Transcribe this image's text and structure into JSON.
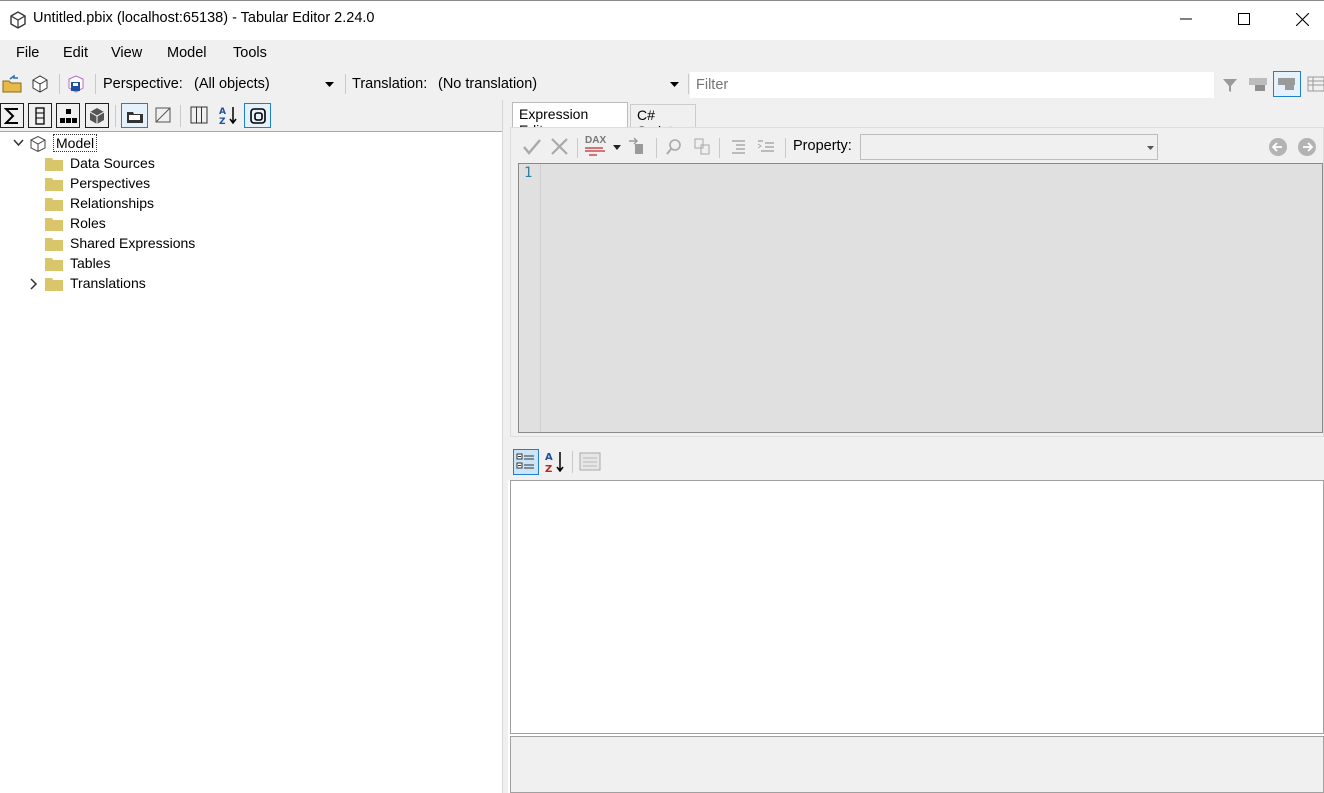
{
  "window": {
    "title": "Untitled.pbix (localhost:65138) - Tabular Editor 2.24.0",
    "icons": {
      "app": "tabular-editor-app-icon",
      "minimize": "minimize-icon",
      "maximize": "maximize-icon",
      "close": "close-icon"
    }
  },
  "menu": {
    "items": [
      "File",
      "Edit",
      "View",
      "Model",
      "Tools"
    ]
  },
  "toolbar": {
    "perspective_label": "Perspective:",
    "perspective_value": "(All objects)",
    "translation_label": "Translation:",
    "translation_value": "(No translation)",
    "filter_placeholder": "Filter"
  },
  "tree": {
    "root": "Model",
    "items": [
      {
        "label": "Data Sources",
        "expandable": false
      },
      {
        "label": "Perspectives",
        "expandable": false
      },
      {
        "label": "Relationships",
        "expandable": false
      },
      {
        "label": "Roles",
        "expandable": false
      },
      {
        "label": "Shared Expressions",
        "expandable": false
      },
      {
        "label": "Tables",
        "expandable": false
      },
      {
        "label": "Translations",
        "expandable": true
      }
    ]
  },
  "editor": {
    "tabs": [
      "Expression Editor",
      "C# Script"
    ],
    "active_tab": "Expression Editor",
    "property_label": "Property:",
    "property_value": "",
    "line_number": "1",
    "dax_badge": "DAX"
  },
  "colors": {
    "chrome": "#f0f0f0",
    "editor_bg": "#e0e0e0",
    "accent": "#1f7fd0",
    "folder": "#d9c66a"
  }
}
